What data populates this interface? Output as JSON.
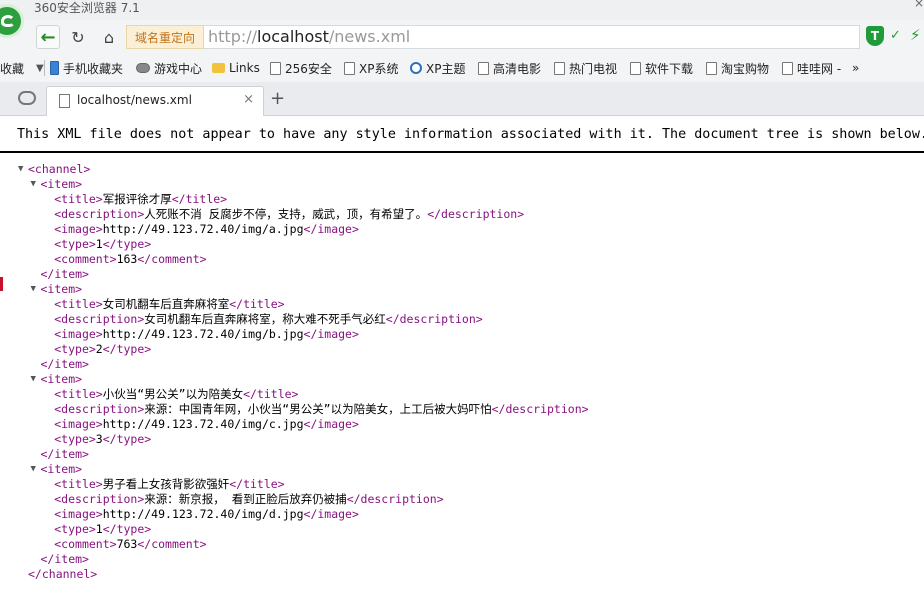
{
  "window": {
    "title": "360安全浏览器 7.1",
    "close": "×"
  },
  "nav": {
    "redirect_label": "域名重定向",
    "url_scheme": "http://",
    "url_host": "localhost",
    "url_path": "/news.xml"
  },
  "bookmarks": [
    "收藏",
    "手机收藏夹",
    "游戏中心",
    "Links",
    "256安全",
    "XP系统",
    "XP主题",
    "高清电影",
    "热门电视",
    "软件下载",
    "淘宝购物",
    "哇哇网 -",
    "»"
  ],
  "tab": {
    "title": "localhost/news.xml",
    "close": "×",
    "new_tab": "+"
  },
  "xml_notice": "This XML file does not appear to have any style information associated with it. The document tree is shown below.",
  "xml": {
    "channel_open": "<channel>",
    "channel_close": "</channel>",
    "item_open": "<item>",
    "item_close": "</item>",
    "items": [
      {
        "fields": [
          {
            "tag": "title",
            "value": "军报评徐才厚"
          },
          {
            "tag": "description",
            "value": "人死账不消 反腐步不停，支持，威武，顶，有希望了。"
          },
          {
            "tag": "image",
            "value": "http://49.123.72.40/img/a.jpg"
          },
          {
            "tag": "type",
            "value": "1"
          },
          {
            "tag": "comment",
            "value": "163"
          }
        ]
      },
      {
        "fields": [
          {
            "tag": "title",
            "value": "女司机翻车后直奔麻将室"
          },
          {
            "tag": "description",
            "value": "女司机翻车后直奔麻将室，称大难不死手气必红"
          },
          {
            "tag": "image",
            "value": "http://49.123.72.40/img/b.jpg"
          },
          {
            "tag": "type",
            "value": "2"
          }
        ]
      },
      {
        "fields": [
          {
            "tag": "title",
            "value": "小伙当“男公关”以为陪美女"
          },
          {
            "tag": "description",
            "value": "来源：中国青年网，小伙当“男公关”以为陪美女，上工后被大妈吓怕"
          },
          {
            "tag": "image",
            "value": "http://49.123.72.40/img/c.jpg"
          },
          {
            "tag": "type",
            "value": "3"
          }
        ]
      },
      {
        "fields": [
          {
            "tag": "title",
            "value": "男子看上女孩背影欲强奸"
          },
          {
            "tag": "description",
            "value": "来源：新京报， 看到正脸后放弃仍被捕"
          },
          {
            "tag": "image",
            "value": "http://49.123.72.40/img/d.jpg"
          },
          {
            "tag": "type",
            "value": "1"
          },
          {
            "tag": "comment",
            "value": "763"
          }
        ]
      }
    ]
  },
  "icons": {
    "back": "back-arrow-icon",
    "refresh": "refresh-icon",
    "home": "home-icon",
    "shield": "security-shield-icon",
    "cloud": "cloud-icon",
    "doc": "document-icon"
  },
  "colors": {
    "xml_tag": "#881280",
    "brand_green": "#2e9f3f",
    "redirect_text": "#c0731b"
  }
}
